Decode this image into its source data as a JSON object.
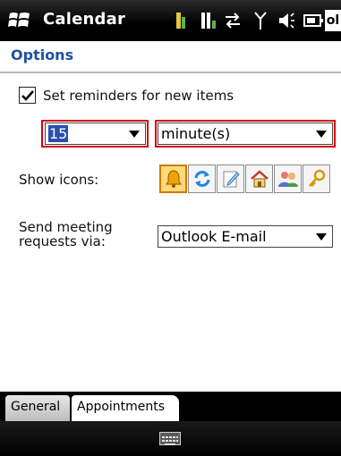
{
  "titlebar": {
    "app_title": "Calendar",
    "clock_fragment": "ol"
  },
  "header": {
    "title": "Options"
  },
  "reminders": {
    "checkbox_label": "Set reminders for new items",
    "checked": true,
    "amount_value": "15",
    "unit_value": "minute(s)"
  },
  "show_icons": {
    "label": "Show icons:",
    "icons": [
      "bell-icon",
      "recurrence-icon",
      "note-icon",
      "home-icon",
      "people-icon",
      "key-icon"
    ],
    "selected_icon": "bell-icon"
  },
  "meeting": {
    "label_line1": "Send meeting",
    "label_line2": "requests via:",
    "value": "Outlook E-mail"
  },
  "tabs": {
    "general": "General",
    "appointments": "Appointments"
  },
  "colors": {
    "title_blue": "#1e4fa8",
    "highlight_red": "#d4000c",
    "selection_blue": "#2a4fb0"
  }
}
